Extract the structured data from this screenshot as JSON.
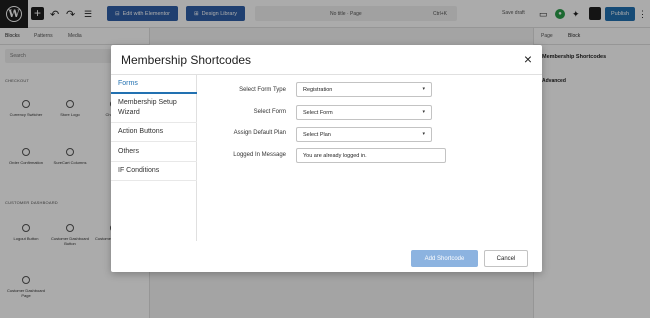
{
  "topbar": {
    "edit_with_elementor": "Edit with Elementor",
    "design_library": "Design Library",
    "doc_title": "No title · Page",
    "shortcut": "Ctrl+K",
    "save_draft": "Save draft",
    "publish": "Publish"
  },
  "left_sidebar": {
    "tabs": [
      "Blocks",
      "Patterns",
      "Media"
    ],
    "search_placeholder": "Search",
    "section_1": "CHECKOUT",
    "section_2": "CUSTOMER DASHBOARD",
    "blocks": [
      "Currency Switcher",
      "Store Logo",
      "Checkout",
      "Order Confirmation",
      "SureCart Columns",
      "Logout Button",
      "Customer Dashboard Button",
      "Customer Dashboard",
      "Customer Dashboard Page"
    ]
  },
  "right_sidebar": {
    "tabs": [
      "Page",
      "Block"
    ],
    "block_name": "Membership Shortcodes",
    "advanced": "Advanced"
  },
  "modal": {
    "title": "Membership Shortcodes",
    "close": "×",
    "nav": [
      "Forms",
      "Membership Setup Wizard",
      "Action Buttons",
      "Others",
      "IF Conditions"
    ],
    "fields": {
      "form_type_label": "Select Form Type",
      "form_type_value": "Registration",
      "form_label": "Select Form",
      "form_value": "Select Form",
      "plan_label": "Assign Default Plan",
      "plan_value": "Select Plan",
      "logged_in_label": "Logged In Message",
      "logged_in_value": "You are already logged in."
    },
    "add_shortcode": "Add Shortcode",
    "cancel": "Cancel"
  },
  "colors": {
    "accent": "#2271b1",
    "add_button": "#8cb3e0",
    "elementor": "#2f5fa8"
  }
}
